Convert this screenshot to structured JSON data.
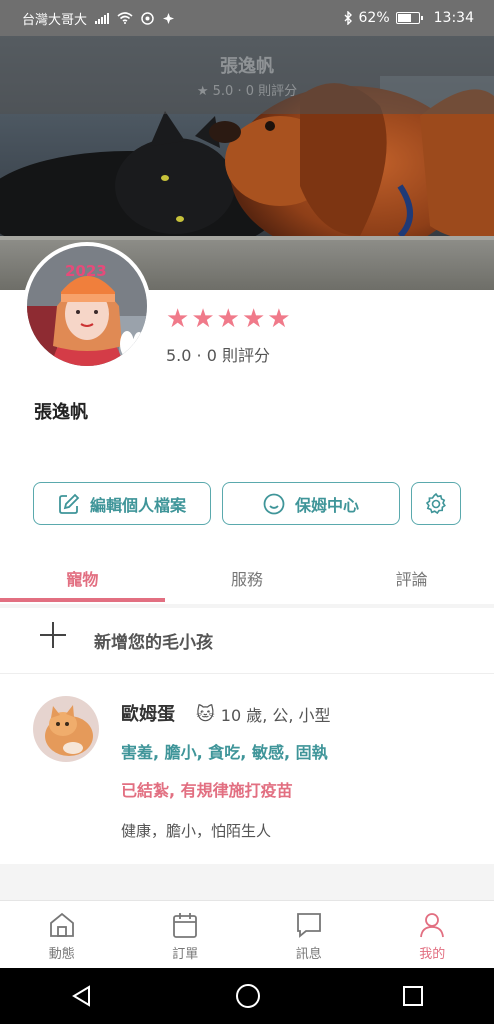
{
  "status_bar": {
    "carrier": "台灣大哥大",
    "battery": "62%",
    "battery_level": 0.62,
    "time": "13:34"
  },
  "cover": {
    "name": "張逸帆",
    "rating": "★ 5.0 · 0 則評分"
  },
  "profile": {
    "rating_value": "5.0 · 0 則評分",
    "stars": 5,
    "name": "張逸帆",
    "edit_button": "編輯個人檔案",
    "nanny_button": "保姆中心"
  },
  "tabs": [
    {
      "label": "寵物",
      "active": true
    },
    {
      "label": "服務",
      "active": false
    },
    {
      "label": "評論",
      "active": false
    }
  ],
  "pets": {
    "add_label": "新增您的毛小孩",
    "items": [
      {
        "name": "歐姆蛋",
        "species_icon": "cat-icon",
        "meta": "10 歲, 公, 小型",
        "traits": "害羞, 膽小, 貪吃, 敏感, 固執",
        "health": "已結紮, 有規律施打疫苗",
        "note": "健康，膽小，怕陌生人"
      }
    ]
  },
  "bottom_nav": [
    {
      "label": "動態",
      "icon": "home-icon",
      "active": false
    },
    {
      "label": "訂單",
      "icon": "calendar-icon",
      "active": false
    },
    {
      "label": "訊息",
      "icon": "chat-icon",
      "active": false
    },
    {
      "label": "我的",
      "icon": "person-icon",
      "active": true
    }
  ],
  "colors": {
    "accent_pink": "#e26f81",
    "accent_teal": "#3f9599"
  }
}
